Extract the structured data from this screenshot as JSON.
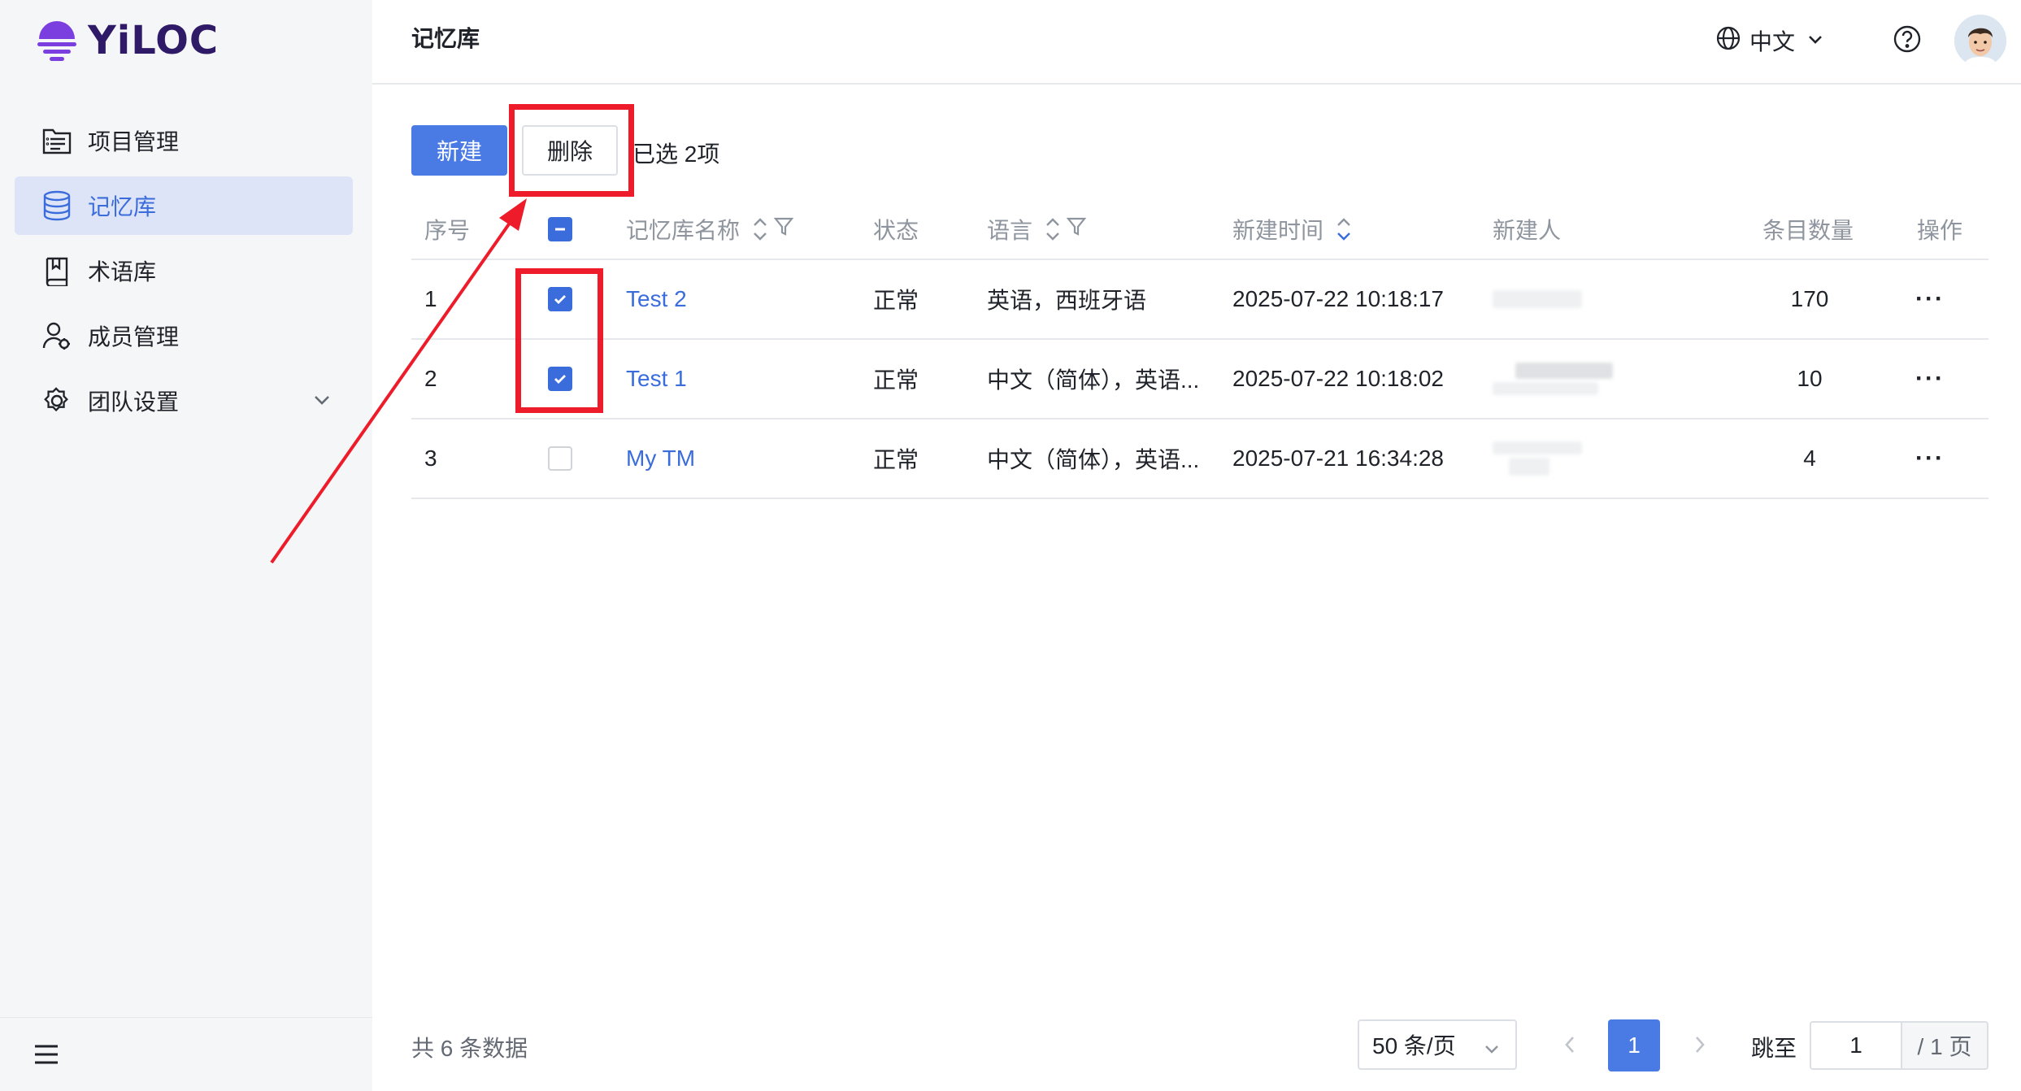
{
  "app": {
    "logo_text": "YiLOC",
    "brand_color": "#6b3fd4"
  },
  "sidebar": {
    "items": [
      {
        "label": "项目管理",
        "icon": "project-list-icon"
      },
      {
        "label": "记忆库",
        "icon": "database-icon",
        "active": true
      },
      {
        "label": "术语库",
        "icon": "book-icon"
      },
      {
        "label": "成员管理",
        "icon": "member-icon"
      },
      {
        "label": "团队设置",
        "icon": "gear-icon",
        "has_submenu": true
      }
    ],
    "collapse_icon": "hamburger-icon"
  },
  "header": {
    "title": "记忆库",
    "language": "中文",
    "help_icon": "help-icon",
    "avatar_icon": "user-avatar"
  },
  "toolbar": {
    "new_label": "新建",
    "delete_label": "删除",
    "selected_info": "已选 2项"
  },
  "table": {
    "columns": {
      "index": "序号",
      "name": "记忆库名称",
      "status": "状态",
      "language": "语言",
      "created_time": "新建时间",
      "creator": "新建人",
      "count": "条目数量",
      "actions": "操作"
    },
    "rows": [
      {
        "index": "1",
        "checked": true,
        "name": "Test 2",
        "status": "正常",
        "language": "英语，西班牙语",
        "created_time": "2025-07-22 10:18:17",
        "count": "170",
        "more": "···"
      },
      {
        "index": "2",
        "checked": true,
        "name": "Test 1",
        "status": "正常",
        "language": "中文（简体），英语...",
        "created_time": "2025-07-22 10:18:02",
        "count": "10",
        "more": "···"
      },
      {
        "index": "3",
        "checked": false,
        "name": "My TM",
        "status": "正常",
        "language": "中文（简体），英语...",
        "created_time": "2025-07-21 16:34:28",
        "count": "4",
        "more": "···"
      }
    ]
  },
  "footer": {
    "total": "共 6 条数据",
    "page_size": "50 条/页",
    "current_page": "1",
    "jump_label": "跳至",
    "jump_value": "1",
    "page_total": "/ 1 页"
  },
  "colors": {
    "accent": "#4a7be5",
    "link": "#3a6cdb",
    "annotation": "#ee1c2a"
  }
}
